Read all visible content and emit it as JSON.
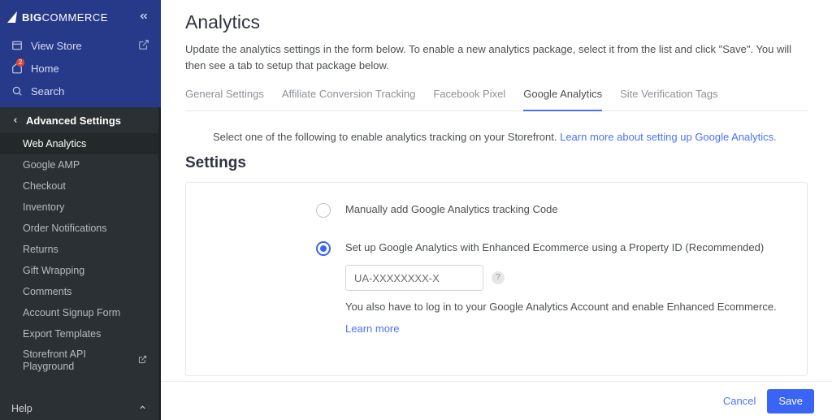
{
  "brand": {
    "name_left": "BIG",
    "name_right": "COMMERCE"
  },
  "topnav": {
    "view_store": "View Store",
    "home": "Home",
    "home_badge": "2",
    "search": "Search"
  },
  "subnav": {
    "header": "Advanced Settings",
    "items": [
      "Web Analytics",
      "Google AMP",
      "Checkout",
      "Inventory",
      "Order Notifications",
      "Returns",
      "Gift Wrapping",
      "Comments",
      "Account Signup Form",
      "Export Templates",
      "Storefront API Playground"
    ],
    "active_index": 0
  },
  "help_label": "Help",
  "page": {
    "title": "Analytics",
    "description": "Update the analytics settings in the form below. To enable a new analytics package, select it from the list and click \"Save\". You will then see a tab to setup that package below."
  },
  "tabs": {
    "items": [
      "General Settings",
      "Affiliate Conversion Tracking",
      "Facebook Pixel",
      "Google Analytics",
      "Site Verification Tags"
    ],
    "active_index": 3
  },
  "hint": {
    "text": "Select one of the following to enable analytics tracking on your Storefront. ",
    "link": "Learn more about setting up Google Analytics."
  },
  "section_title": "Settings",
  "options": {
    "manual_label": "Manually add Google Analytics tracking Code",
    "enhanced_label": "Set up Google Analytics with Enhanced Ecommerce using a Property ID (Recommended)",
    "input_value": "UA-XXXXXXXX-X",
    "note": "You also have to log in to your Google Analytics Account and enable Enhanced Ecommerce.",
    "learn_more": "Learn more",
    "selected": "enhanced"
  },
  "footer": {
    "cancel": "Cancel",
    "save": "Save"
  }
}
